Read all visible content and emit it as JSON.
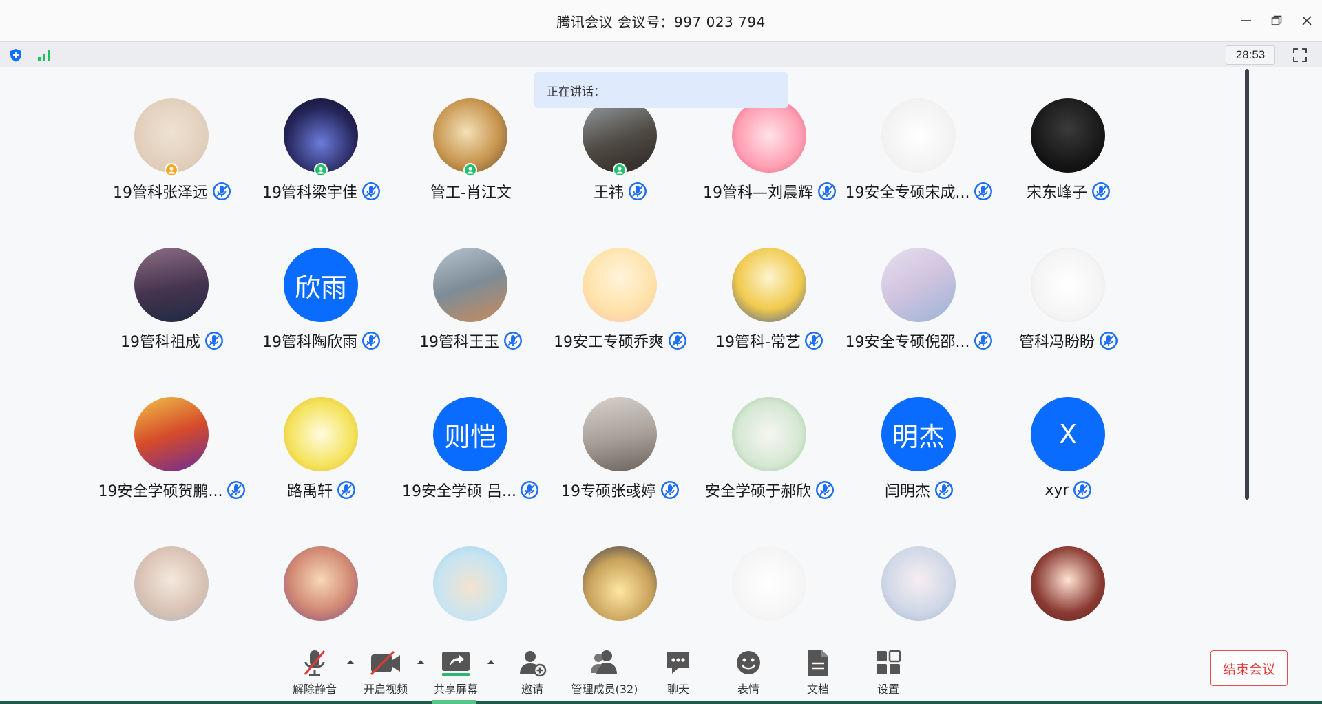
{
  "window": {
    "title": "腾讯会议 会议号：997 023 794",
    "minimize": "minimize",
    "restore": "restore",
    "close": "close"
  },
  "infobar": {
    "timer": "28:53"
  },
  "speaking": {
    "label": "正在讲话："
  },
  "participants": [
    {
      "name": "19管科张泽远",
      "muted": true,
      "badge": "host",
      "badge_color": "#f5a623"
    },
    {
      "name": "19管科梁宇佳",
      "muted": true,
      "badge": "cohost",
      "badge_color": "#1fc26b"
    },
    {
      "name": "管工-肖江文",
      "muted": false,
      "badge": "cohost",
      "badge_color": "#1fc26b"
    },
    {
      "name": "王祎",
      "muted": true,
      "badge": "cohost",
      "badge_color": "#1fc26b"
    },
    {
      "name": "19管科—刘晨辉",
      "muted": true
    },
    {
      "name": "19安全专硕宋成...",
      "muted": true
    },
    {
      "name": "宋东峰子",
      "muted": true
    },
    {
      "name": "19管科祖成",
      "muted": true
    },
    {
      "name": "19管科陶欣雨",
      "muted": true,
      "initials": "欣雨"
    },
    {
      "name": "19管科王玉",
      "muted": true
    },
    {
      "name": "19安工专硕乔爽",
      "muted": true
    },
    {
      "name": "19管科-常艺",
      "muted": true
    },
    {
      "name": "19安全专硕倪邵...",
      "muted": true
    },
    {
      "name": "管科冯盼盼",
      "muted": true
    },
    {
      "name": "19安全学硕贺鹏...",
      "muted": true
    },
    {
      "name": "路禹轩",
      "muted": true
    },
    {
      "name": "19安全学硕 吕...",
      "muted": true,
      "initials": "则恺"
    },
    {
      "name": "19专硕张彧婷",
      "muted": true
    },
    {
      "name": "安全学硕于郝欣",
      "muted": true
    },
    {
      "name": "闫明杰",
      "muted": true,
      "initials": "明杰"
    },
    {
      "name": "xyr",
      "muted": true,
      "initials": "X"
    },
    {
      "name": "",
      "muted": false
    },
    {
      "name": "",
      "muted": false
    },
    {
      "name": "",
      "muted": false
    },
    {
      "name": "",
      "muted": false
    },
    {
      "name": "",
      "muted": false
    },
    {
      "name": "",
      "muted": false
    },
    {
      "name": "",
      "muted": false
    }
  ],
  "toolbar": {
    "unmute": "解除静音",
    "video": "开启视频",
    "share": "共享屏幕",
    "invite": "邀请",
    "members": "管理成员(32)",
    "chat": "聊天",
    "reactions": "表情",
    "docs": "文档",
    "settings": "设置",
    "end": "结束会议"
  },
  "colors": {
    "accent": "#0a6cff",
    "end_red": "#e33e3e",
    "green": "#1fc26b"
  },
  "icons": {
    "security": "shield-plus-icon",
    "signal": "signal-bars-icon",
    "fullscreen": "fullscreen-icon"
  }
}
